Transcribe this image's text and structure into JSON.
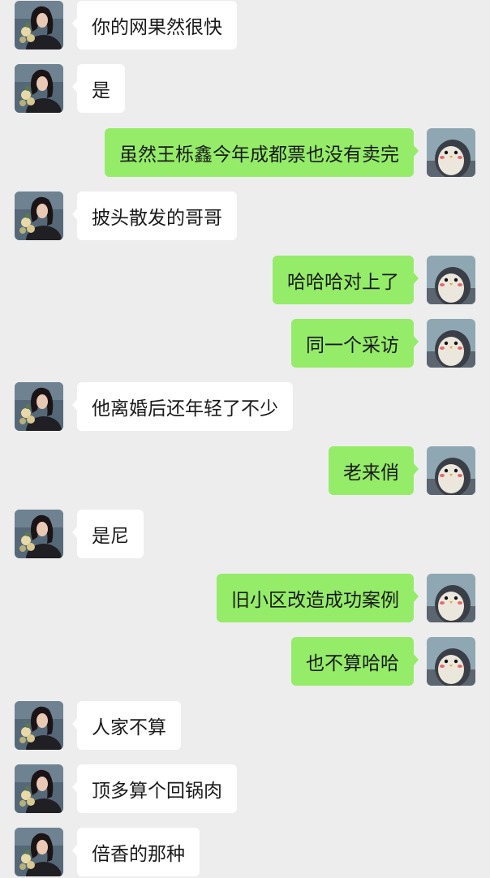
{
  "colors": {
    "background": "#ededed",
    "incoming_bubble": "#ffffff",
    "outgoing_bubble": "#95ec69",
    "text": "#1a1a1a"
  },
  "messages": [
    {
      "side": "left",
      "text": "你的网果然很快"
    },
    {
      "side": "left",
      "text": "是"
    },
    {
      "side": "right",
      "text": "虽然王栎鑫今年成都票也没有卖完"
    },
    {
      "side": "left",
      "text": "披头散发的哥哥"
    },
    {
      "side": "right",
      "text": "哈哈哈对上了"
    },
    {
      "side": "right",
      "text": "同一个采访"
    },
    {
      "side": "left",
      "text": "他离婚后还年轻了不少"
    },
    {
      "side": "right",
      "text": "老来俏"
    },
    {
      "side": "left",
      "text": "是尼"
    },
    {
      "side": "right",
      "text": "旧小区改造成功案例"
    },
    {
      "side": "right",
      "text": "也不算哈哈"
    },
    {
      "side": "left",
      "text": "人家不算"
    },
    {
      "side": "left",
      "text": "顶多算个回锅肉"
    },
    {
      "side": "left",
      "text": "倍香的那种"
    }
  ],
  "avatars": {
    "left": "woman-portrait-avatar",
    "right": "penguin-avatar"
  }
}
